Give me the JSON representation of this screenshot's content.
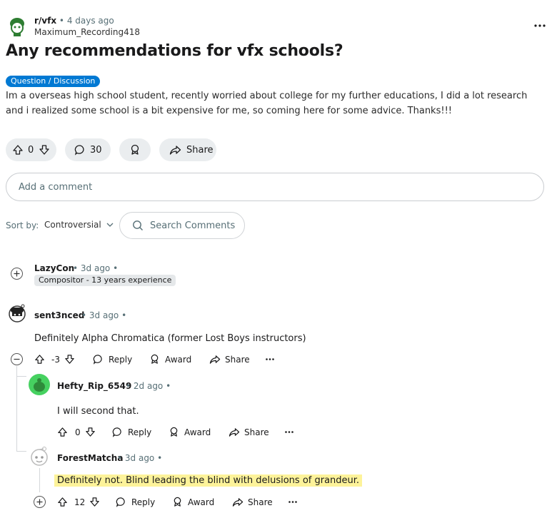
{
  "post": {
    "subreddit": "r/vfx",
    "time": "• 4 days ago",
    "author": "Maximum_Recording418",
    "title": "Any recommendations for vfx schools?",
    "flair": "Question / Discussion",
    "body": "Im a overseas high school student, recently worried about college for my further educations, I did a lot research and i realized some school is a bit expensive for me, so coming here for some advice. Thanks!!!",
    "votes": "0",
    "comments": "30",
    "share_label": "Share"
  },
  "comment_input": {
    "placeholder": "Add a comment"
  },
  "sort": {
    "label": "Sort by:",
    "value": "Controversial"
  },
  "search": {
    "placeholder": "Search Comments"
  },
  "comments": [
    {
      "user": "LazyCon",
      "time": "• 3d ago •",
      "flair": "Compositor - 13 years experience"
    },
    {
      "user": "sent3nced",
      "time": "• 3d ago •",
      "text": "Definitely Alpha Chromatica (former Lost Boys instructors)",
      "votes": "-3",
      "reply": "Reply",
      "award": "Award",
      "share": "Share"
    },
    {
      "user": "Hefty_Rip_6549",
      "time": "• 2d ago •",
      "text": "I will second that.",
      "votes": "0",
      "reply": "Reply",
      "award": "Award",
      "share": "Share"
    },
    {
      "user": "ForestMatcha",
      "time": "• 3d ago •",
      "text": "Definitely not. Blind leading the blind with delusions of grandeur.",
      "votes": "12",
      "reply": "Reply",
      "award": "Award",
      "share": "Share"
    }
  ],
  "colors": {
    "flair_bg": "#0079d3",
    "highlight": "#fdf39a",
    "pill_bg": "#eaedef",
    "avatar_green": "#46d160"
  }
}
